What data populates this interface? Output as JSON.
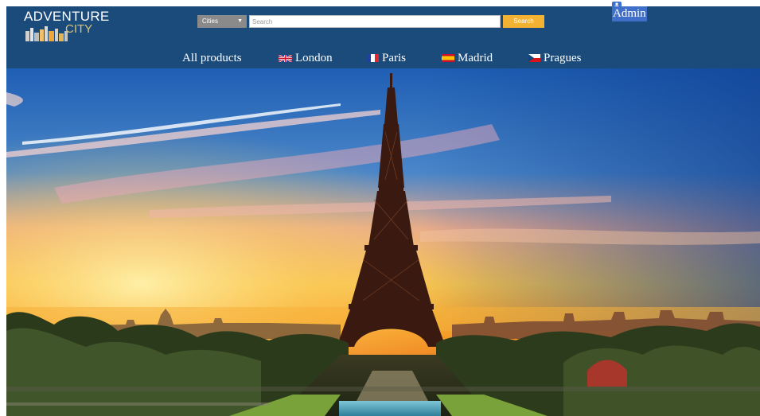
{
  "header": {
    "logo": {
      "line1": "ADVENTURE",
      "line2": "CITY"
    },
    "search": {
      "city_select_value": "Cities",
      "placeholder": "Search",
      "button_label": "Search"
    },
    "admin": {
      "label": "Admin",
      "icon": "user-icon"
    }
  },
  "nav": {
    "items": [
      {
        "label": "All products"
      },
      {
        "label": "London",
        "icon": "uk-flag-icon"
      },
      {
        "label": "Paris",
        "icon": "france-flag-icon"
      },
      {
        "label": "Madrid",
        "icon": "spain-flag-icon"
      },
      {
        "label": "Pragues",
        "icon": "czech-flag-icon"
      }
    ]
  },
  "colors": {
    "header_bg": "#1b4b7b",
    "search_button": "#f4b233",
    "admin_highlight": "#3f6fc8",
    "city_select": "#8a8a8a"
  }
}
